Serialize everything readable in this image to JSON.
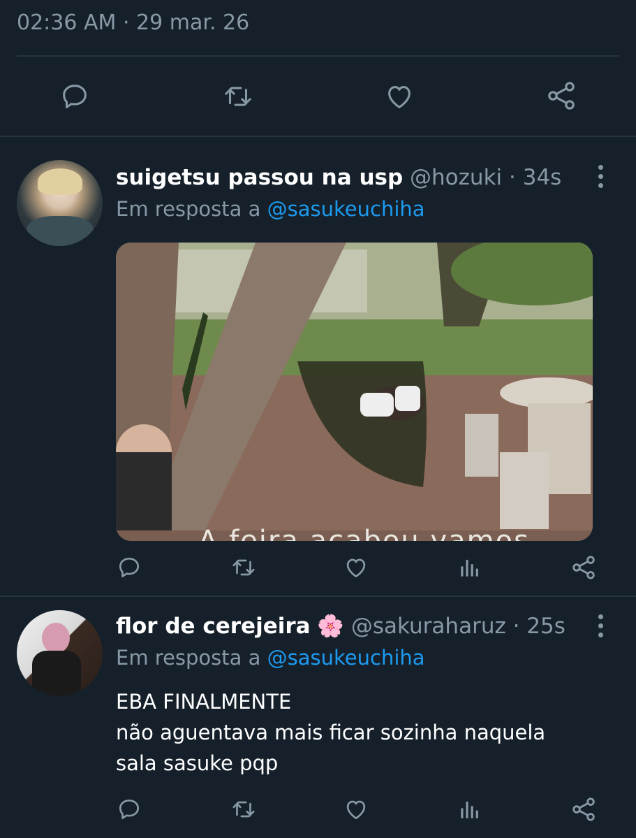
{
  "focused_tweet": {
    "time": "02:36 AM",
    "separator": "·",
    "date": "29 mar. 26",
    "actions": [
      "reply-icon",
      "retweet-icon",
      "like-icon",
      "share-icon"
    ]
  },
  "replies": [
    {
      "display_name": "suigetsu passou na usp",
      "handle": "@hozuki",
      "separator": "·",
      "time": "34s",
      "reply_prefix": "Em resposta a",
      "reply_to": "@sasukeuchiha",
      "media": {
        "type": "video-frame",
        "caption_partial": "A feira acabou vamos"
      },
      "actions": [
        "reply-icon",
        "retweet-icon",
        "like-icon",
        "analytics-icon",
        "share-icon"
      ]
    },
    {
      "display_name": "flor de cerejeira",
      "name_emoji": "🌸",
      "handle": "@sakuraharuz",
      "separator": "·",
      "time": "25s",
      "reply_prefix": "Em resposta a",
      "reply_to": "@sasukeuchiha",
      "text_lines": [
        "EBA FINALMENTE",
        "não aguentava mais ficar sozinha naquela",
        "sala sasuke pqp"
      ],
      "actions": [
        "reply-icon",
        "retweet-icon",
        "like-icon",
        "analytics-icon",
        "share-icon"
      ]
    }
  ],
  "colors": {
    "background": "#15202b",
    "muted": "#8899a6",
    "link": "#1d9bf0",
    "divider": "#253341"
  }
}
